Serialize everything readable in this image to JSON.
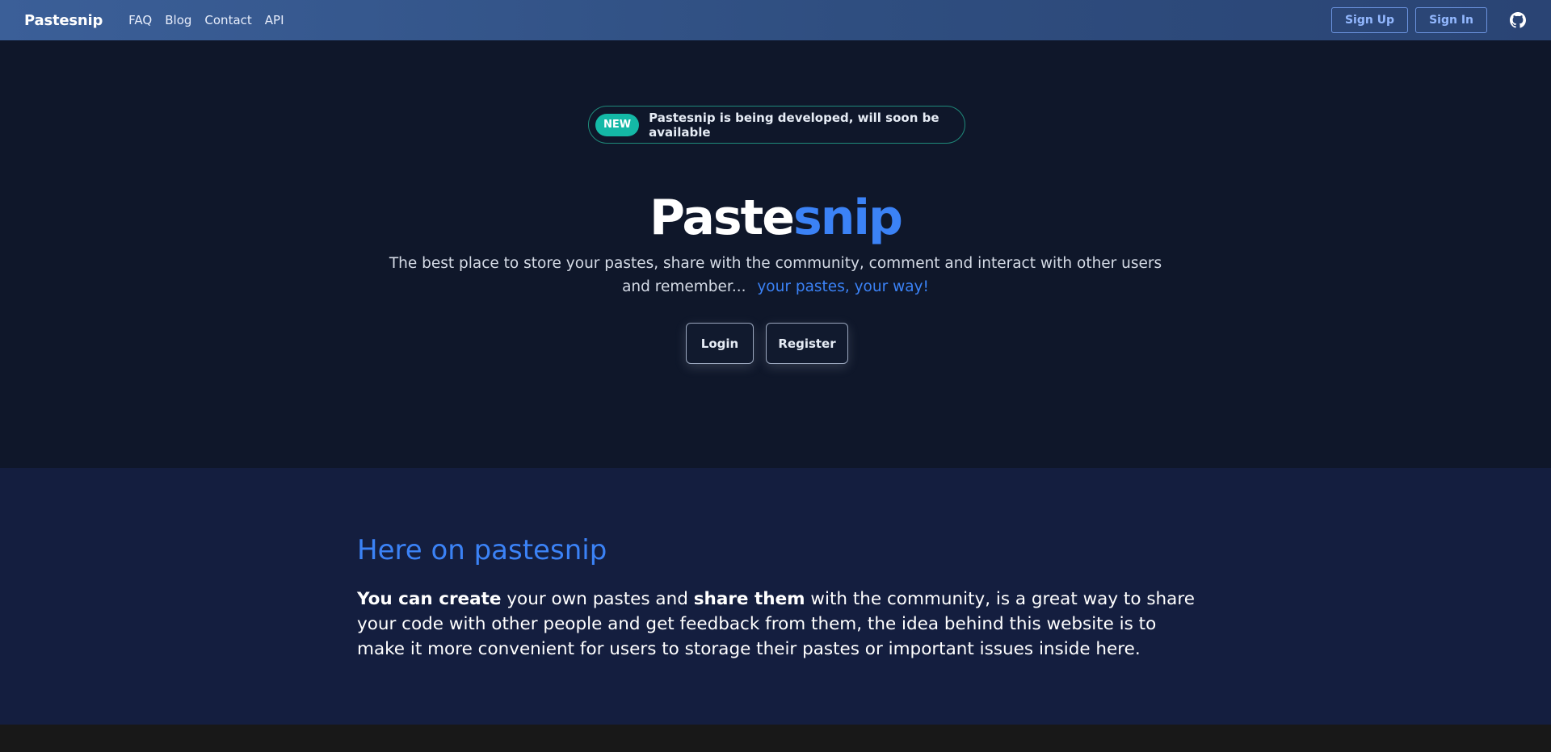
{
  "navbar": {
    "brand": "Pastesnip",
    "links": [
      "FAQ",
      "Blog",
      "Contact",
      "API"
    ],
    "sign_up": "Sign Up",
    "sign_in": "Sign In",
    "github_icon": "github-icon"
  },
  "hero": {
    "badge_label": "NEW",
    "badge_text": "Pastesnip is being developed, will soon be available",
    "title_part1": "Paste",
    "title_part2": "snip",
    "subtitle": "The best place to store your pastes, share with the community, comment and interact with other users and remember...",
    "subtitle_accent": "your pastes, your way!",
    "login_button": "Login",
    "register_button": "Register"
  },
  "features": {
    "title": "Here on pastesnip",
    "body_bold1": "You can create",
    "body_text1": " your own pastes and ",
    "body_bold2": "share them",
    "body_text2": " with the community, is a great way to share your code with other people and get feedback from them, the idea behind this website is to make it more convenient for users to storage their pastes or important issues inside here."
  },
  "colors": {
    "accent": "#3b82f6",
    "badge_teal": "#14b8a6",
    "hero_bg": "#0f172a",
    "features_bg": "#141e3f"
  }
}
